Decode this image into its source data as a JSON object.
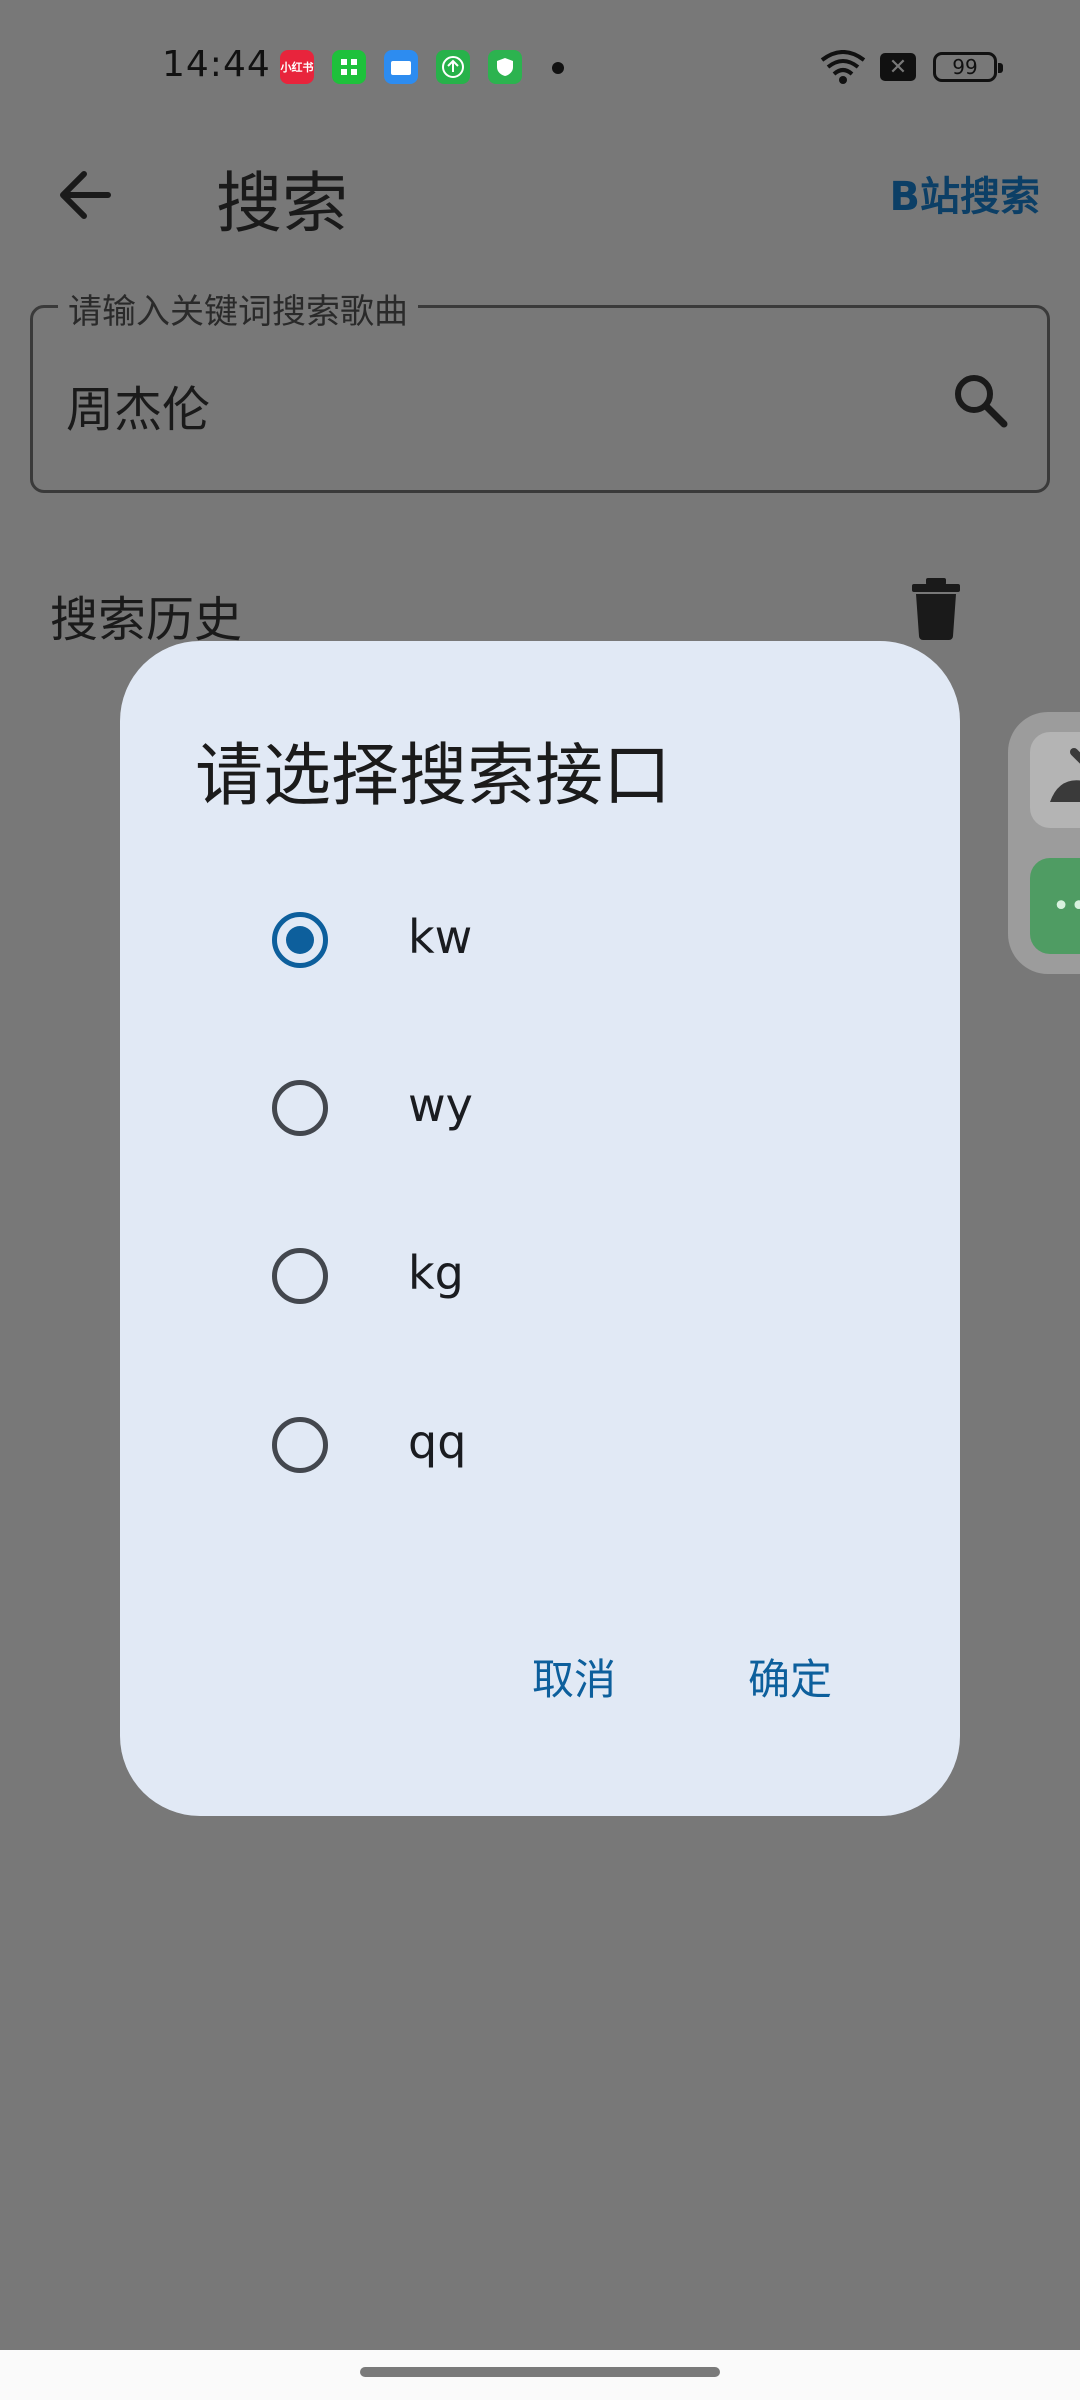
{
  "status_bar": {
    "time": "14:44",
    "battery": "99",
    "app_icons": [
      {
        "name": "xiaohongshu-icon",
        "label": "小红书",
        "color": "#e8243c"
      },
      {
        "name": "app-store-icon",
        "label": "",
        "color": "#1ec13b"
      },
      {
        "name": "files-icon",
        "label": "",
        "color": "#2d8cf0"
      },
      {
        "name": "upload-icon",
        "label": "",
        "color": "#27b24a"
      },
      {
        "name": "shield-icon",
        "label": "",
        "color": "#2cb34f"
      }
    ]
  },
  "app_bar": {
    "title": "搜索",
    "action": "B站搜索"
  },
  "search": {
    "label": "请输入关键词搜索歌曲",
    "value": "周杰伦"
  },
  "history": {
    "title": "搜索历史"
  },
  "dialog": {
    "title": "请选择搜索接口",
    "options": [
      {
        "label": "kw",
        "selected": true
      },
      {
        "label": "wy",
        "selected": false
      },
      {
        "label": "kg",
        "selected": false
      },
      {
        "label": "qq",
        "selected": false
      }
    ],
    "cancel": "取消",
    "confirm": "确定"
  },
  "colors": {
    "accent": "#0d5f9c",
    "dialog_bg": "#e1e9f5",
    "scrim": "#787878"
  }
}
